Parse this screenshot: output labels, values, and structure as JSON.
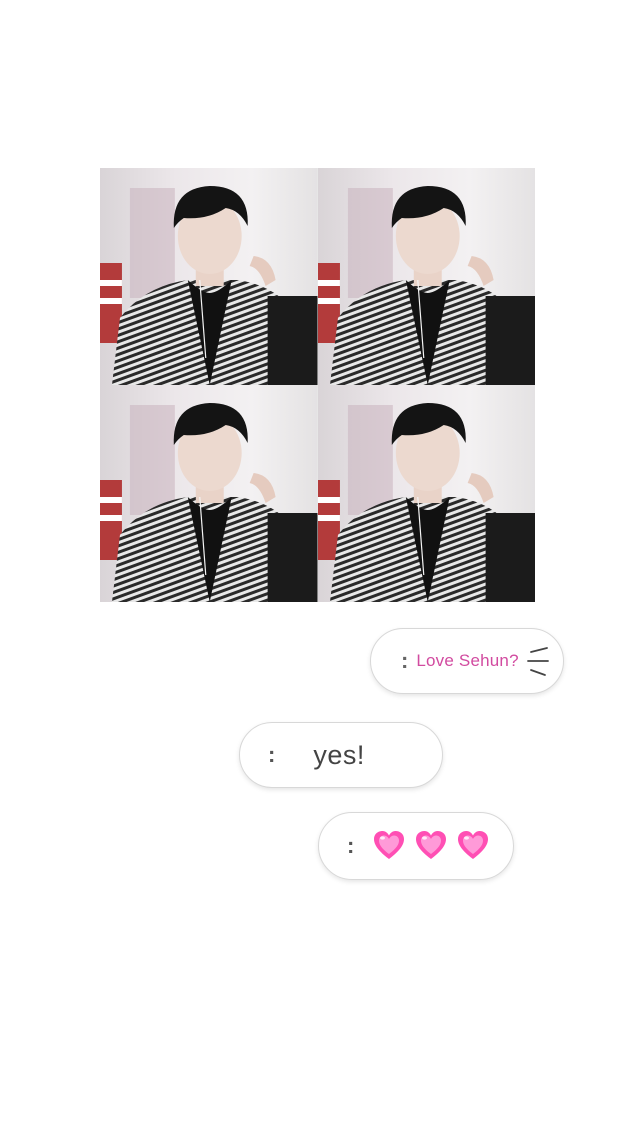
{
  "photo_grid": {
    "tiles": [
      {
        "icon": "portrait-photo"
      },
      {
        "icon": "portrait-photo"
      },
      {
        "icon": "portrait-photo"
      },
      {
        "icon": "portrait-photo"
      }
    ]
  },
  "messages": {
    "first": {
      "prefix": ":",
      "text": "Love Sehun?",
      "color": "#d24ba0",
      "icon": "emphasis-lines-icon"
    },
    "second": {
      "prefix": ":",
      "text": "yes!"
    },
    "third": {
      "prefix": ":",
      "icons": [
        "pink-heart-icon",
        "pink-heart-icon",
        "pink-heart-icon"
      ],
      "heart_color": "#ff4fb4"
    }
  }
}
